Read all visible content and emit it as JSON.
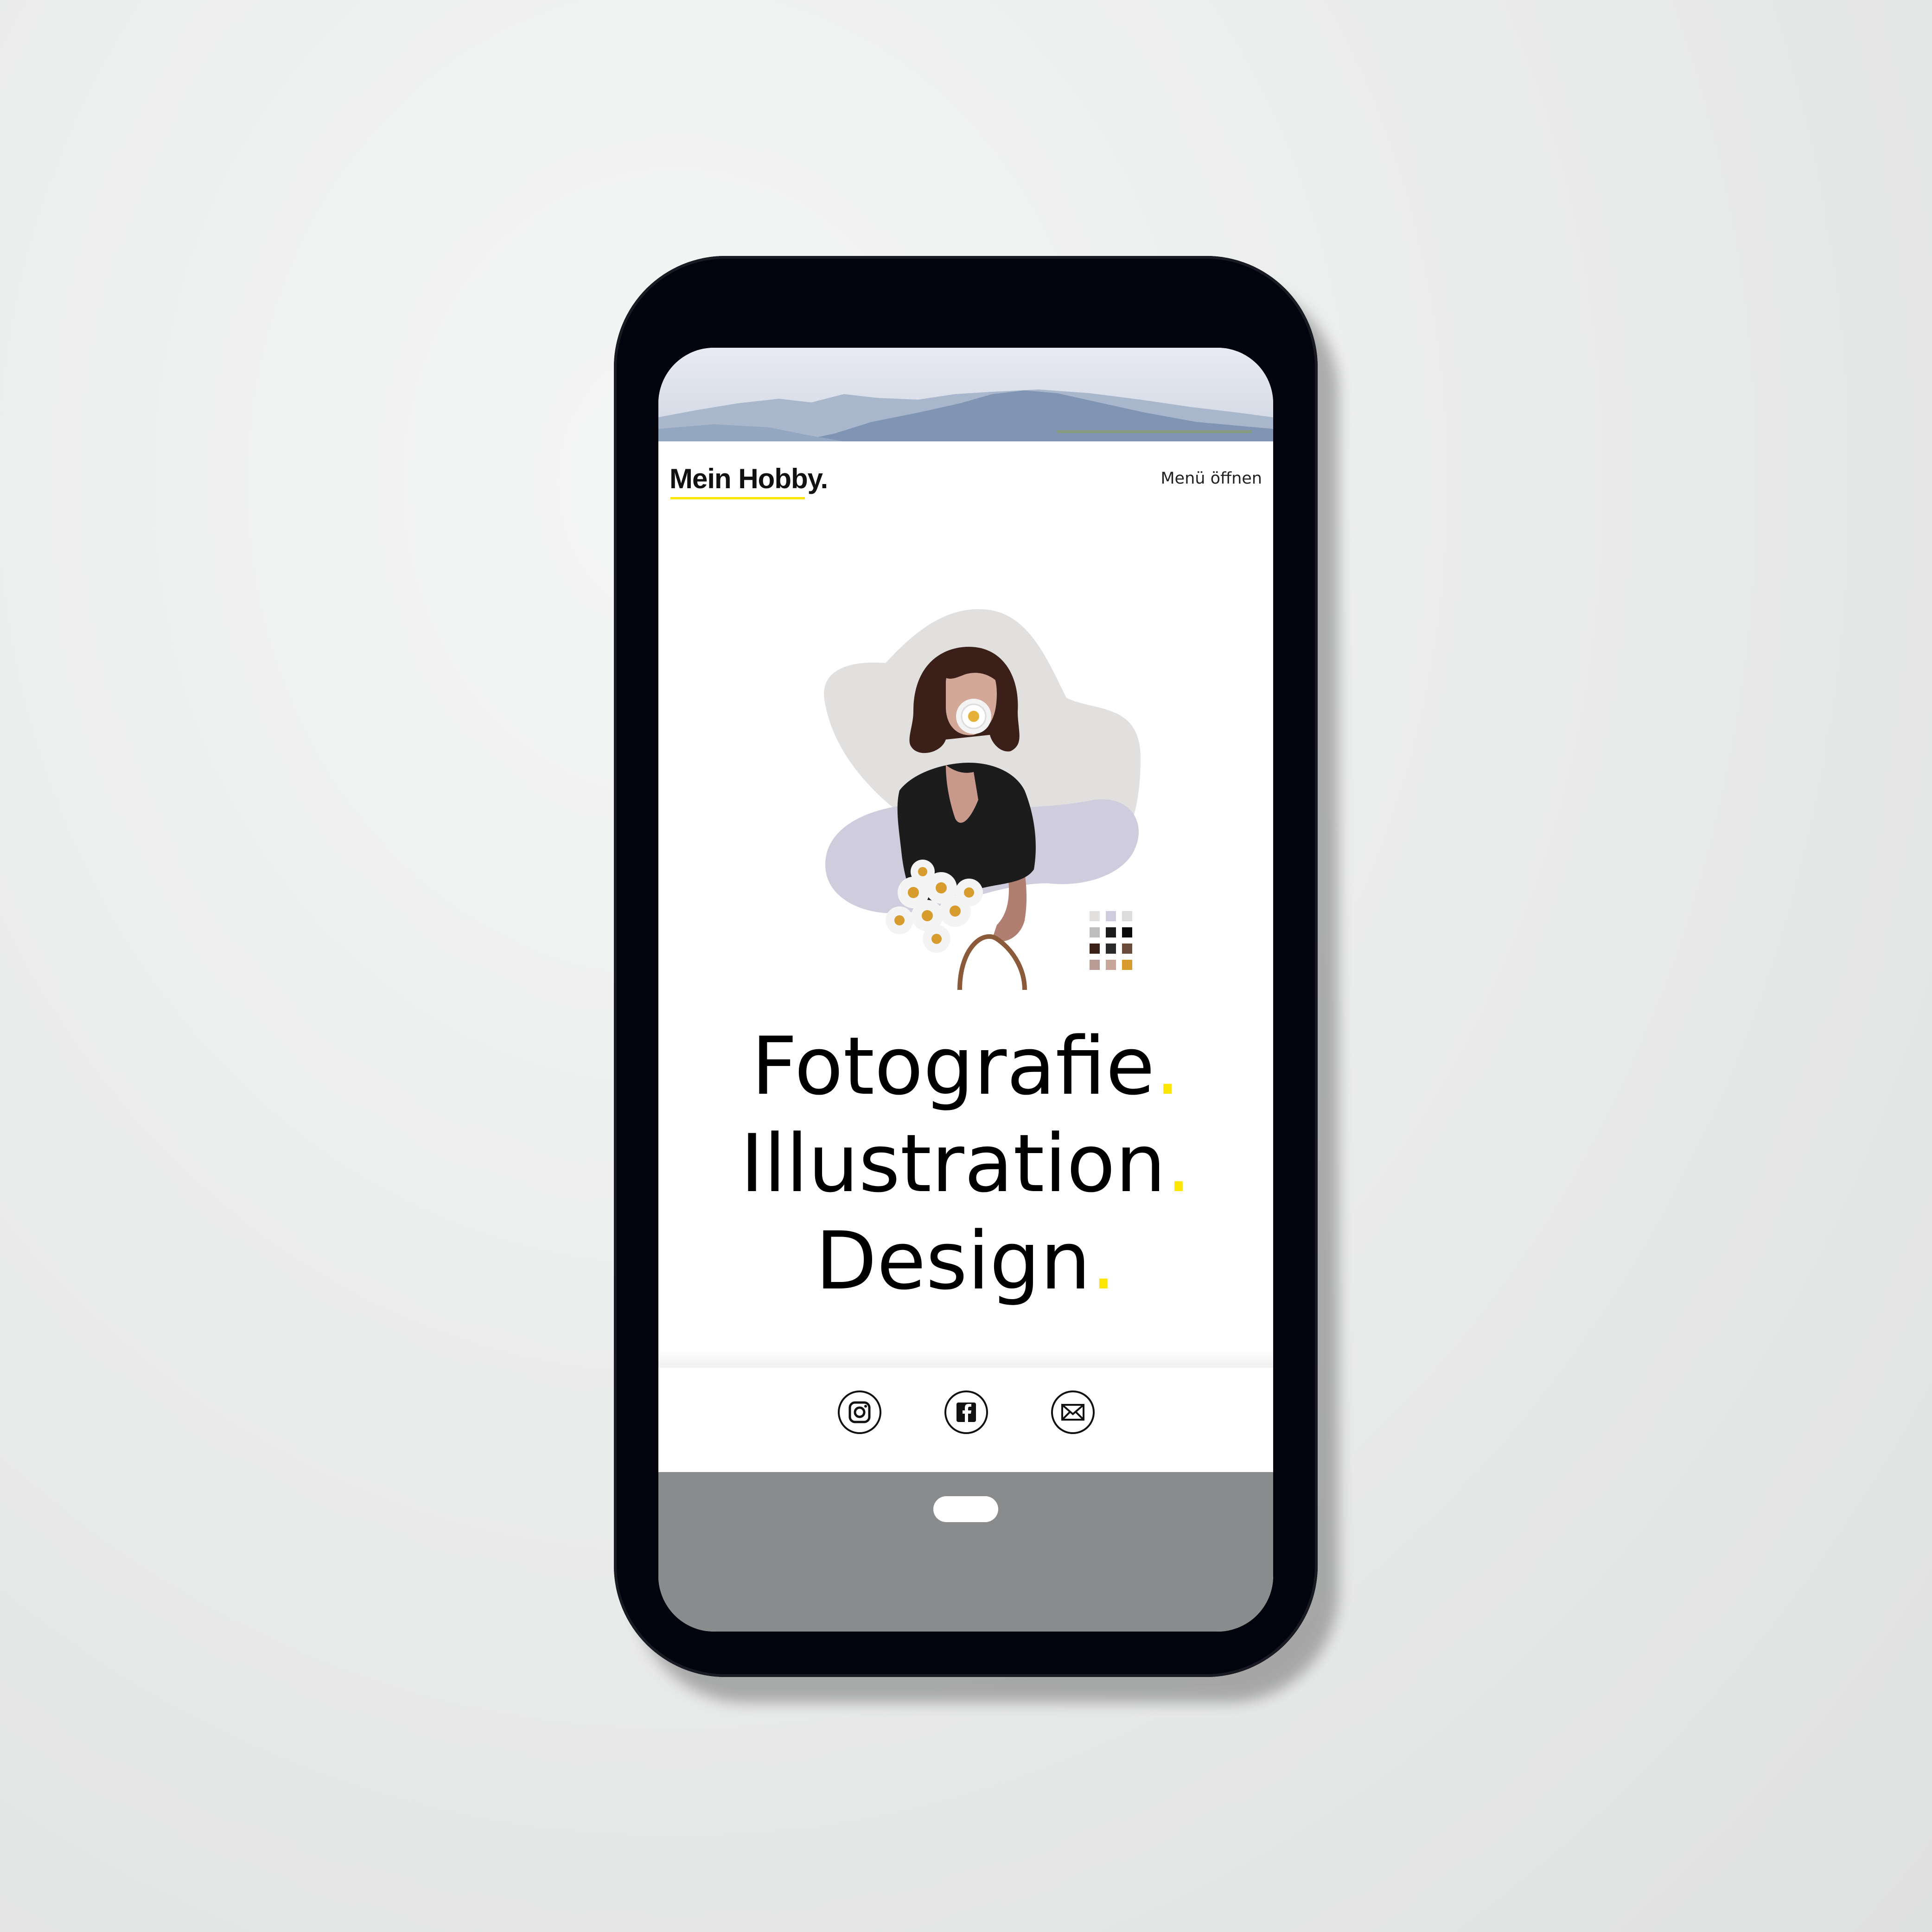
{
  "header": {
    "brand": "Mein Hobby.",
    "menu_label": "Menü öffnen"
  },
  "banner": {
    "image": "mountain-landscape-photo"
  },
  "hero": {
    "illustration": "woman-with-daisies-illustration",
    "lines": [
      {
        "text": "Fotografie",
        "dot": "."
      },
      {
        "text": "Illustration",
        "dot": "."
      },
      {
        "text": "Design",
        "dot": "."
      }
    ]
  },
  "footer": {
    "social": [
      {
        "name": "instagram-icon"
      },
      {
        "name": "facebook-icon"
      },
      {
        "name": "mail-icon"
      }
    ]
  },
  "colors": {
    "accent": "#ffe600",
    "text": "#000000",
    "phone_frame": "#02030c",
    "home_bar": "#8a8b8c"
  }
}
